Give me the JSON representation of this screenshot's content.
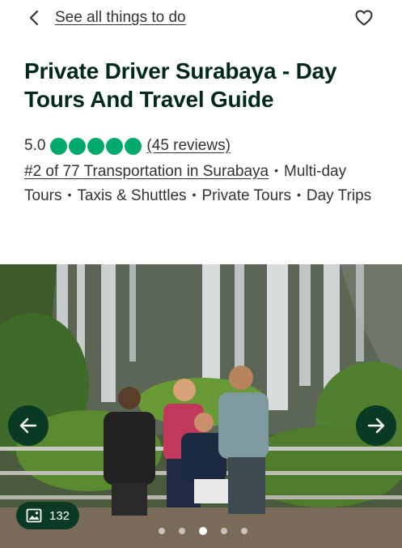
{
  "header": {
    "back_label": "See all things to do"
  },
  "listing": {
    "title": "Private Driver Surabaya - Day Tours And Travel Guide",
    "rating": "5.0",
    "bubbles_filled": 5,
    "bubbles_total": 5,
    "reviews_label": "(45 reviews)",
    "rank_label": "#2 of 77 Transportation in Surabaya",
    "categories": [
      "Multi-day Tours",
      "Taxis & Shuttles",
      "Private Tours",
      "Day Trips"
    ]
  },
  "gallery": {
    "photo_count": "132",
    "slides_total": 5,
    "active_slide": 3
  },
  "colors": {
    "accent_green": "#00aa6c",
    "dark_green": "#0b3a24",
    "title_color": "#00291c"
  }
}
